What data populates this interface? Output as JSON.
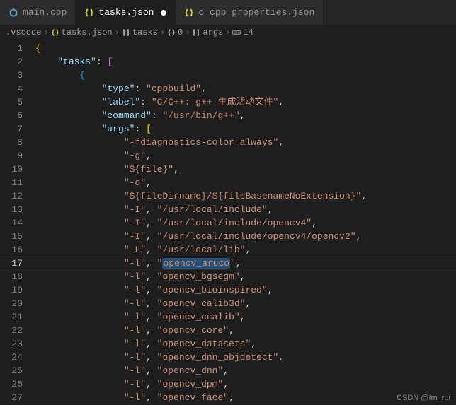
{
  "tabs": [
    {
      "label": "main.cpp",
      "icon": "cpp",
      "active": false,
      "dirty": false
    },
    {
      "label": "tasks.json",
      "icon": "json",
      "active": true,
      "dirty": true
    },
    {
      "label": "c_cpp_properties.json",
      "icon": "json",
      "active": false,
      "dirty": false
    }
  ],
  "breadcrumb": {
    "parts": [
      ".vscode",
      "tasks.json",
      "tasks",
      "0",
      "args",
      "14"
    ],
    "icons": [
      "",
      "braces-json",
      "brackets",
      "braces",
      "brackets",
      "abc"
    ]
  },
  "activeLine": 17,
  "lineNumbers": [
    "1",
    "2",
    "3",
    "4",
    "5",
    "6",
    "7",
    "8",
    "9",
    "10",
    "11",
    "12",
    "13",
    "14",
    "15",
    "16",
    "17",
    "18",
    "19",
    "20",
    "21",
    "22",
    "23",
    "24",
    "25",
    "26",
    "27"
  ],
  "json_content": {
    "tasks_key": "tasks",
    "item": {
      "type_key": "type",
      "type_val": "cppbuild",
      "label_key": "label",
      "label_val": "C/C++: g++ 生成活动文件",
      "command_key": "command",
      "command_val": "/usr/bin/g++",
      "args_key": "args",
      "args": [
        "-fdiagnostics-color=always",
        "-g",
        "${file}",
        "-o",
        "${fileDirname}/${fileBasenameNoExtension}",
        "-I",
        "/usr/local/include",
        "-I",
        "/usr/local/include/opencv4",
        "-I",
        "/usr/local/include/opencv4/opencv2",
        "-L",
        "/usr/local/lib",
        "-l",
        "opencv_aruco",
        "-l",
        "opencv_bgsegm",
        "-l",
        "opencv_bioinspired",
        "-l",
        "opencv_calib3d",
        "-l",
        "opencv_ccalib",
        "-l",
        "opencv_core",
        "-l",
        "opencv_datasets",
        "-l",
        "opencv_dnn_objdetect",
        "-l",
        "opencv_dnn",
        "-l",
        "opencv_dpm",
        "-l",
        "opencv_face"
      ]
    }
  },
  "highlighted_text": "opencv_aruco",
  "watermark": "CSDN @Im_rui"
}
